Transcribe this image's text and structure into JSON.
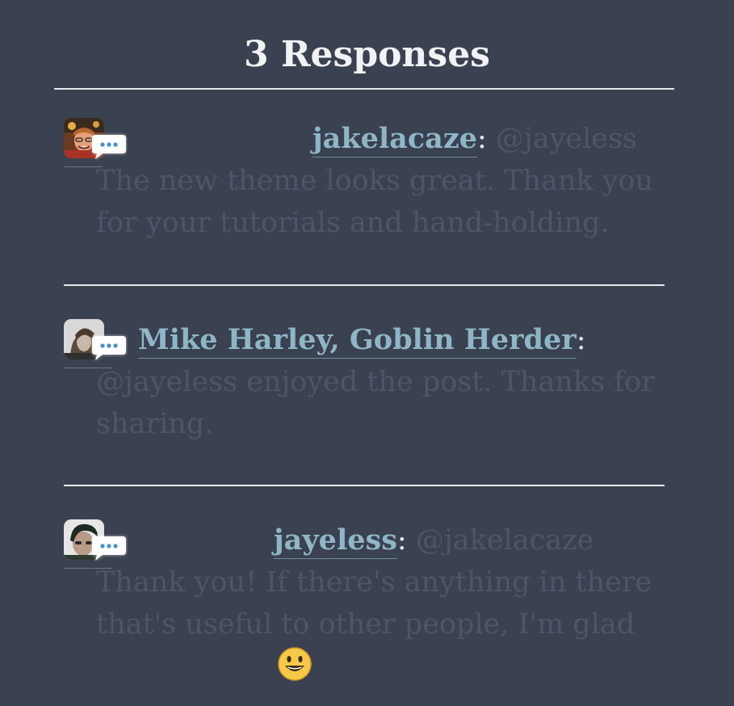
{
  "heading": "3 Responses",
  "responses": [
    {
      "author": "jakelacaze",
      "separator": ":",
      "text": "@jayeless The new theme looks great. Thank you for your tutorials and hand-holding."
    },
    {
      "author": "Mike Harley, Goblin Herder",
      "separator": ":",
      "text": "@jayeless enjoyed the post. Thanks for sharing."
    },
    {
      "author": "jayeless",
      "separator": ":",
      "text": "@jakelacaze Thank you! If there's anything in there that's useful to other people, I'm glad"
    }
  ],
  "icons": {
    "reply": "speech-bubble-icon",
    "emoji": "smiling-face-icon"
  },
  "colors": {
    "background": "#3a4150",
    "heading": "#f1f2f4",
    "author_link": "#8fb6c6",
    "faded_text": "#4d5668",
    "rule": "#e8eaee",
    "bubble": "#ffffff",
    "bubble_dots": "#4a90c8",
    "emoji": "#f7c948"
  }
}
